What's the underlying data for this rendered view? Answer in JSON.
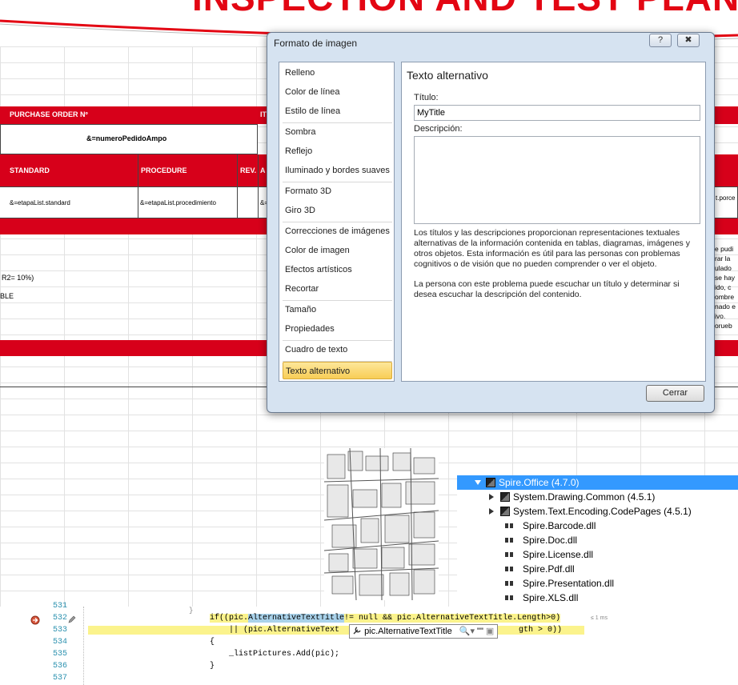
{
  "banner": {
    "title": "INSPECTION AND TEST PLAN"
  },
  "sheet": {
    "header1": "PURCHASE ORDER Nº",
    "header1_right": "IT",
    "order_value": "&=numeroPedidoAmpo",
    "col_standard": "STANDARD",
    "col_procedure": "PROCEDURE",
    "col_rev": "REV.",
    "col_a": "A",
    "standard_value": "&=etapaList.standard",
    "procedure_value": "&=etapaList.procedimiento",
    "small_value": "&=",
    "right_value": "t.porce",
    "note1": "R2= 10%)",
    "note2": "BLE",
    "right_text": [
      "e pudi",
      "rar la",
      "ulado",
      "se hay",
      "ido, c",
      "ombre",
      "nado e",
      "ivo.",
      "orueb"
    ]
  },
  "dialog": {
    "title": "Formato de imagen",
    "help_btn": "?",
    "categories": [
      "Relleno",
      "Color de línea",
      "Estilo de línea",
      "Sombra",
      "Reflejo",
      "Iluminado y bordes suaves",
      "Formato 3D",
      "Giro 3D",
      "Correcciones de imágenes",
      "Color de imagen",
      "Efectos artísticos",
      "Recortar",
      "Tamaño",
      "Propiedades",
      "Cuadro de texto",
      "Texto alternativo"
    ],
    "section_title": "Texto alternativo",
    "title_label": "Título:",
    "title_value": "MyTitle",
    "desc_label": "Descripción:",
    "desc_value": "",
    "help_p1": "Los títulos y las descripciones proporcionan representaciones textuales alternativas de la información contenida en tablas, diagramas, imágenes y otros objetos. Esta información es útil para las personas con problemas cognitivos o de visión que no pueden comprender o ver el objeto.",
    "help_p2": "La persona con este problema puede escuchar un título y determinar si desea escuchar la descripción del contenido.",
    "close_label": "Cerrar"
  },
  "tree": {
    "items": [
      {
        "label": "Spire.Office (4.7.0)",
        "kind": "pkg",
        "expanded": true
      },
      {
        "label": "System.Drawing.Common (4.5.1)",
        "kind": "pkg",
        "expanded": false
      },
      {
        "label": "System.Text.Encoding.CodePages (4.5.1)",
        "kind": "pkg",
        "expanded": false
      },
      {
        "label": "Spire.Barcode.dll",
        "kind": "dll"
      },
      {
        "label": "Spire.Doc.dll",
        "kind": "dll"
      },
      {
        "label": "Spire.License.dll",
        "kind": "dll"
      },
      {
        "label": "Spire.Pdf.dll",
        "kind": "dll"
      },
      {
        "label": "Spire.Presentation.dll",
        "kind": "dll"
      },
      {
        "label": "Spire.XLS.dll",
        "kind": "dll"
      }
    ]
  },
  "code": {
    "line_numbers": [
      "531",
      "532",
      "533",
      "534",
      "535",
      "536",
      "537"
    ],
    "line532_a": "if((pic.",
    "line532_tok": "AlternativeTextTitle",
    "line532_b": "!= null && pic.AlternativeTextTitle.Length>0)",
    "line533": "|| (pic.AlternativeText",
    "line533_end": "gth > 0))",
    "line534": "{",
    "line535": "_listPictures.Add(pic);",
    "line536": "}",
    "perf_tip": "≤ 1 ms",
    "tooltip_text": "pic.AlternativeTextTitle",
    "tooltip_value": "\"\""
  }
}
